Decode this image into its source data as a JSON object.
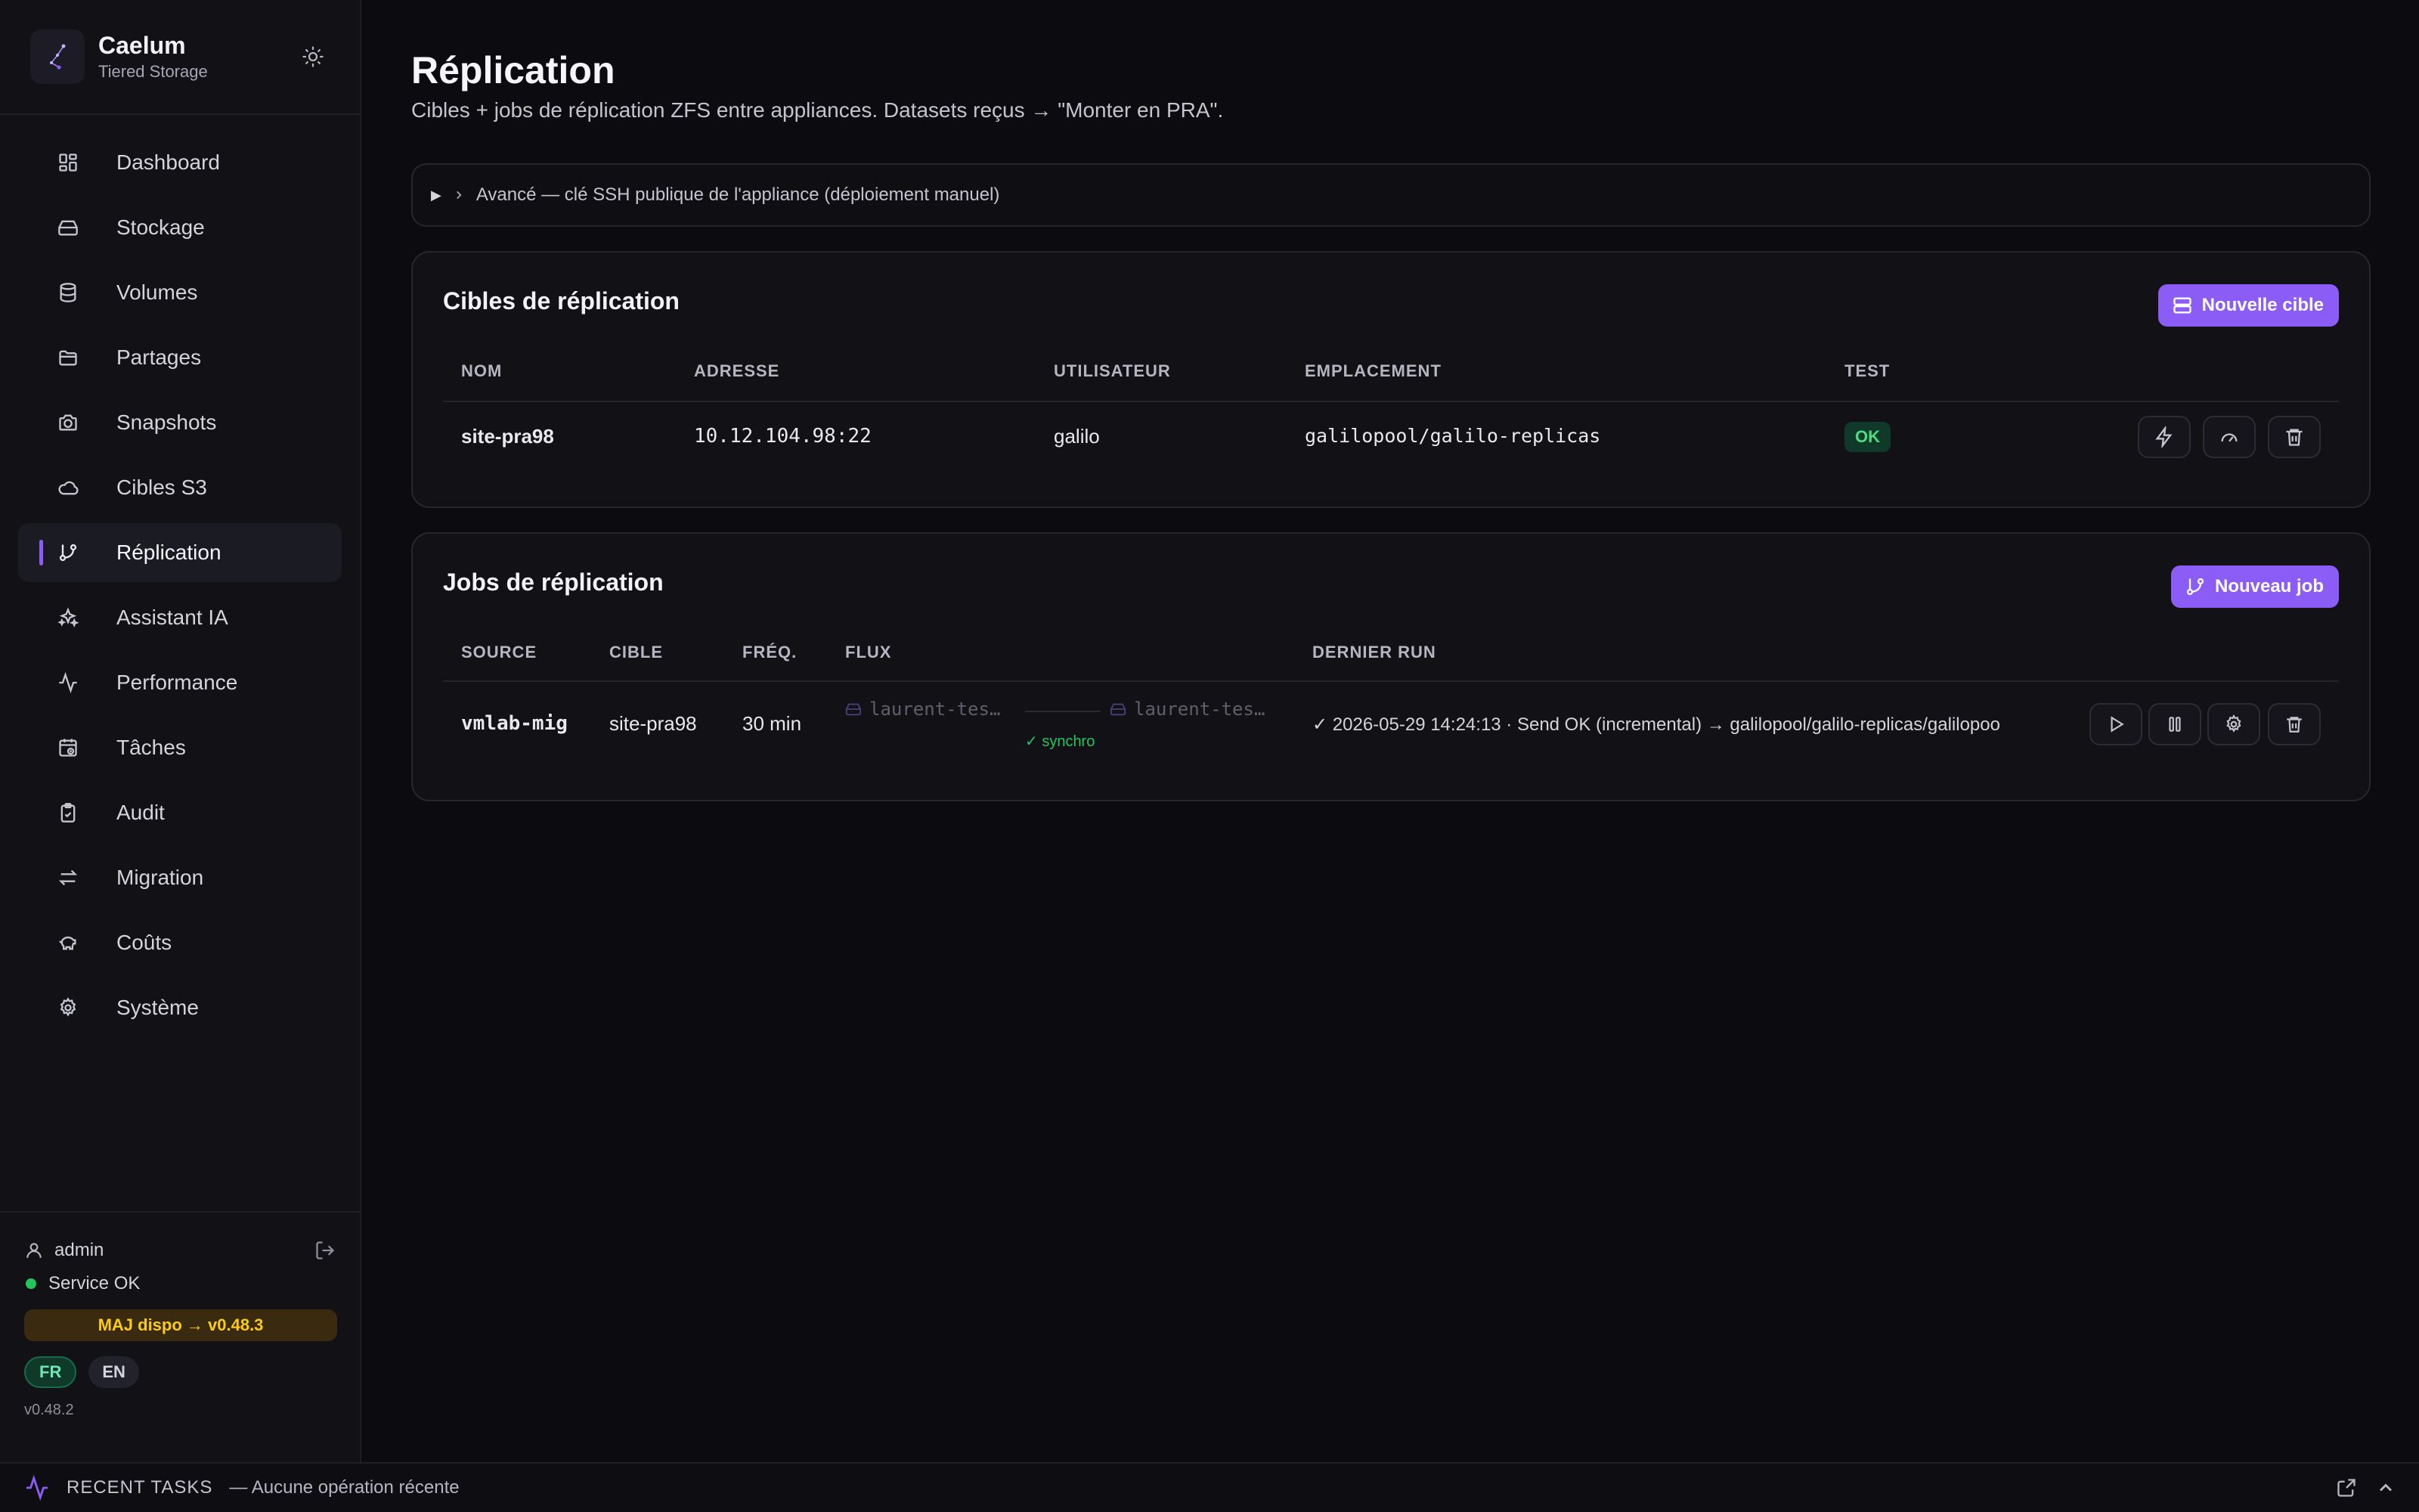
{
  "brand": {
    "name": "Caelum",
    "subtitle": "Tiered Storage"
  },
  "nav": [
    {
      "label": "Dashboard",
      "icon": "dashboard-icon"
    },
    {
      "label": "Stockage",
      "icon": "storage-icon"
    },
    {
      "label": "Volumes",
      "icon": "database-icon"
    },
    {
      "label": "Partages",
      "icon": "folder-icon"
    },
    {
      "label": "Snapshots",
      "icon": "camera-icon"
    },
    {
      "label": "Cibles S3",
      "icon": "cloud-icon"
    },
    {
      "label": "Réplication",
      "icon": "git-branch-icon",
      "active": true
    },
    {
      "label": "Assistant IA",
      "icon": "sparkles-icon"
    },
    {
      "label": "Performance",
      "icon": "activity-icon"
    },
    {
      "label": "Tâches",
      "icon": "calendar-clock-icon"
    },
    {
      "label": "Audit",
      "icon": "clipboard-check-icon"
    },
    {
      "label": "Migration",
      "icon": "arrows-swap-icon"
    },
    {
      "label": "Coûts",
      "icon": "piggy-bank-icon"
    },
    {
      "label": "Système",
      "icon": "gear-icon"
    }
  ],
  "footer": {
    "user": "admin",
    "status": "Service OK",
    "update": "MAJ dispo → v0.48.3",
    "lang_fr": "FR",
    "lang_en": "EN",
    "version": "v0.48.2"
  },
  "page": {
    "title": "Réplication",
    "subtitle": "Cibles + jobs de réplication ZFS entre appliances. Datasets reçus → \"Monter en PRA\".",
    "advanced": "Avancé — clé SSH publique de l'appliance (déploiement manuel)"
  },
  "targets": {
    "title": "Cibles de réplication",
    "new_button": "Nouvelle cible",
    "columns": [
      "NOM",
      "ADRESSE",
      "UTILISATEUR",
      "EMPLACEMENT",
      "TEST"
    ],
    "rows": [
      {
        "name": "site-pra98",
        "address": "10.12.104.98:22",
        "user": "galilo",
        "location": "galilopool/galilo-replicas",
        "test": "OK"
      }
    ]
  },
  "jobs": {
    "title": "Jobs de réplication",
    "new_button": "Nouveau job",
    "columns": [
      "SOURCE",
      "CIBLE",
      "FRÉQ.",
      "FLUX",
      "DERNIER RUN"
    ],
    "rows": [
      {
        "source": "vmlab-mig",
        "target": "site-pra98",
        "freq": "30 min",
        "flux_src": "laurent-tes…",
        "flux_dst": "laurent-tes…",
        "flux_status": "✓ synchro",
        "last_run": "✓ 2026-05-29 14:24:13 · Send OK (incremental) → galilopool/galilo-replicas/galilopoo"
      }
    ]
  },
  "bottombar": {
    "label": "RECENT TASKS",
    "message": "— Aucune opération récente"
  },
  "colors": {
    "accent": "#8b5cf6",
    "ok": "#4ade80",
    "warn": "#facc15"
  }
}
